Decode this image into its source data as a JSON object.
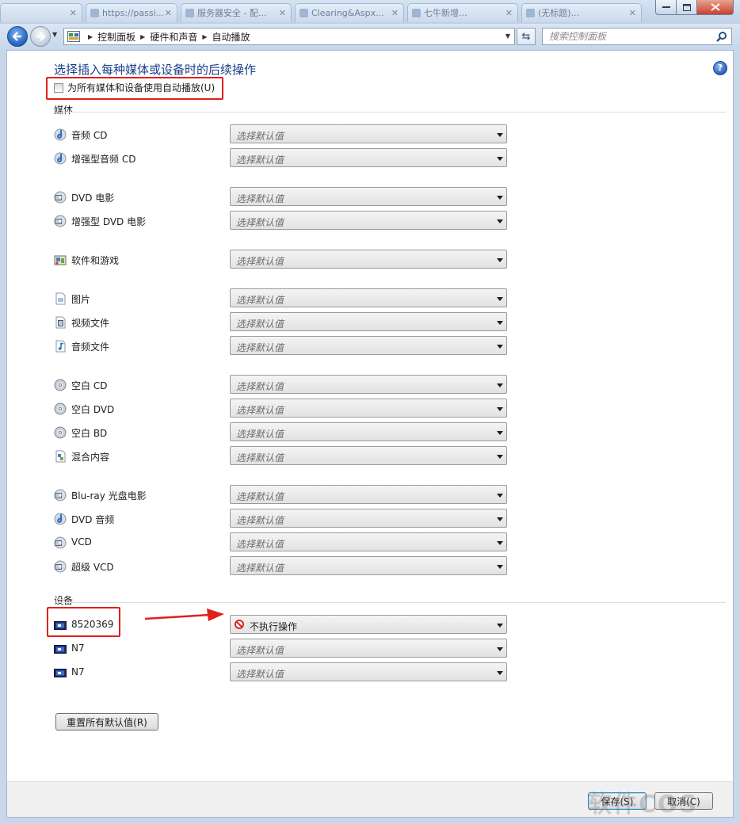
{
  "tabs": [
    {
      "label": ""
    },
    {
      "label": "https://passi..."
    },
    {
      "label": "服务器安全 - 配..."
    },
    {
      "label": "Clearing&Aspx..."
    },
    {
      "label": "七牛新增..."
    },
    {
      "label": "(无标题)..."
    }
  ],
  "breadcrumb": [
    "控制面板",
    "硬件和声音",
    "自动播放"
  ],
  "search": {
    "placeholder": "搜索控制面板"
  },
  "page_title": "选择插入每种媒体或设备时的后续操作",
  "autoplay_all_label": "为所有媒体和设备使用自动播放(U)",
  "sections": {
    "media": "媒体",
    "devices": "设备"
  },
  "default_placeholder": "选择默认值",
  "media_items": [
    {
      "label": "音频 CD",
      "icon": "audio-cd-icon",
      "value": "选择默认值"
    },
    {
      "label": "增强型音频 CD",
      "icon": "audio-cd-icon",
      "value": "选择默认值"
    },
    {
      "label": "DVD 电影",
      "icon": "dvd-movie-icon",
      "value": "选择默认值"
    },
    {
      "label": "增强型 DVD 电影",
      "icon": "dvd-movie-icon",
      "value": "选择默认值"
    },
    {
      "label": "软件和游戏",
      "icon": "software-icon",
      "value": "选择默认值"
    },
    {
      "label": "图片",
      "icon": "picture-icon",
      "value": "选择默认值"
    },
    {
      "label": "视频文件",
      "icon": "video-file-icon",
      "value": "选择默认值"
    },
    {
      "label": "音频文件",
      "icon": "audio-file-icon",
      "value": "选择默认值"
    },
    {
      "label": "空白 CD",
      "icon": "blank-disc-icon",
      "value": "选择默认值"
    },
    {
      "label": "空白 DVD",
      "icon": "blank-disc-icon",
      "value": "选择默认值"
    },
    {
      "label": "空白 BD",
      "icon": "blank-disc-icon",
      "value": "选择默认值"
    },
    {
      "label": "混合内容",
      "icon": "mixed-content-icon",
      "value": "选择默认值"
    },
    {
      "label": "Blu-ray 光盘电影",
      "icon": "dvd-movie-icon",
      "value": "选择默认值"
    },
    {
      "label": "DVD 音频",
      "icon": "audio-cd-icon",
      "value": "选择默认值"
    },
    {
      "label": "VCD",
      "icon": "dvd-movie-icon",
      "value": "选择默认值"
    },
    {
      "label": "超级 VCD",
      "icon": "dvd-movie-icon",
      "value": "选择默认值"
    }
  ],
  "device_items": [
    {
      "label": "8520369",
      "icon": "device-icon",
      "value": "不执行操作"
    },
    {
      "label": "N7",
      "icon": "device-icon",
      "value": "选择默认值"
    },
    {
      "label": "N7",
      "icon": "device-icon",
      "value": "选择默认值"
    }
  ],
  "reset_label": "重置所有默认值(R)",
  "footer": {
    "save": "保存(S)",
    "cancel": "取消(C)"
  },
  "watermark": "软件COS",
  "colors": {
    "title_blue": "#1a3e8c",
    "highlight_red": "#e0201b",
    "panel_bg": "#ffffff",
    "frame": "#c9d7e8"
  }
}
